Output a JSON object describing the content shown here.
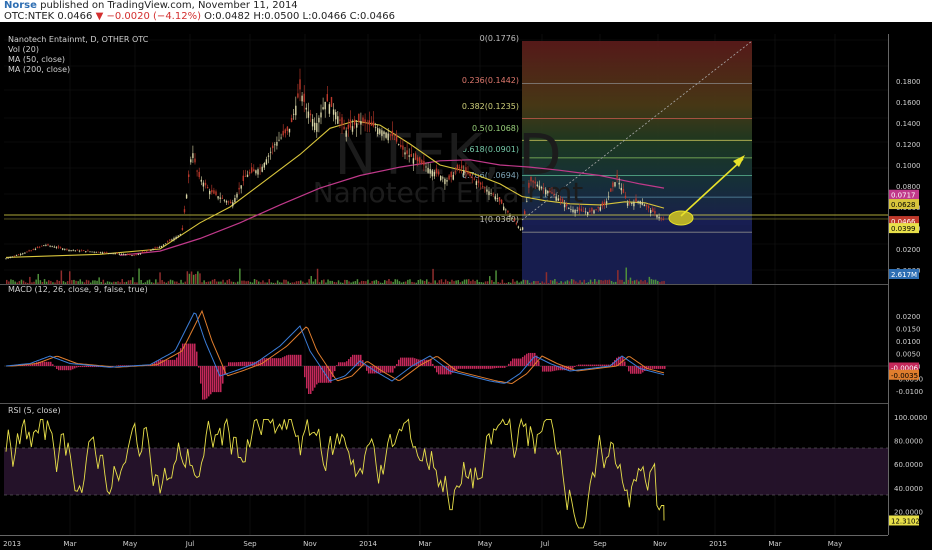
{
  "header": {
    "author": "Norse",
    "published": "published on TradingView.com, November 11, 2014",
    "symbol": "OTC:NTEK",
    "last": "0.0466",
    "change": "−0.0020 (−4.12%)",
    "open": "O:0.0482",
    "high": "H:0.0500",
    "low": "L:0.0466",
    "close": "C:0.0466"
  },
  "main_pane": {
    "title": "Nanotech Entainmt, D, OTHER OTC",
    "indicators": [
      "Vol (20)",
      "MA (50, close)",
      "MA (200, close)"
    ],
    "watermark_symbol": "NTEK, D",
    "watermark_name": "Nanotech Entainmt"
  },
  "macd_pane": {
    "title": "MACD (12, 26, close, 9, false, true)"
  },
  "rsi_pane": {
    "title": "RSI (5, close)"
  },
  "colors": {
    "price": "#d9d5a7",
    "ma50": "#d8c53c",
    "ma200": "#c0398a",
    "macd": "#3b7dd8",
    "signal": "#e07d2d",
    "hist": "#c4285a",
    "rsi": "#e8e04a",
    "arrow": "#e8e22a"
  },
  "chart_data": [
    {
      "type": "line",
      "pane": "price",
      "x": [
        "2013-01",
        "2013-03",
        "2013-05",
        "2013-07",
        "2013-09",
        "2013-11",
        "2014-01",
        "2014-03",
        "2014-05",
        "2014-06",
        "2014-07",
        "2014-09",
        "2014-11"
      ],
      "series": [
        {
          "values": [
            0.012,
            0.022,
            0.018,
            0.06,
            0.095,
            0.17,
            0.145,
            0.115,
            0.085,
            0.036,
            0.08,
            0.065,
            0.047
          ]
        }
      ],
      "y_ticks": [
        "0.1800",
        "0.1600",
        "0.1400",
        "0.1200",
        "0.1000",
        "0.0800",
        "0.0600",
        "0.0400",
        "0.0200",
        "0.0000"
      ],
      "price_labels": [
        "0.0717",
        "0.0628",
        "0.0466",
        "0.0399",
        "2.617M"
      ],
      "fib_levels": [
        "0(0.1776)",
        "0.236(0.1442)",
        "0.382(0.1235)",
        "0.5(0.1068)",
        "0.618(0.0901)",
        "0.786(0.0694)",
        "1(0.0360)"
      ],
      "fib_values": [
        0.1776,
        0.1442,
        0.1235,
        0.1068,
        0.0901,
        0.0694,
        0.036
      ]
    },
    {
      "type": "line",
      "pane": "macd",
      "y_ticks": [
        "0.0200",
        "0.0150",
        "0.0100",
        "0.0050",
        "0.0000",
        "-0.0050",
        "-0.0100"
      ],
      "price_labels": [
        "-0.0006",
        "-0.0035"
      ]
    },
    {
      "type": "line",
      "pane": "rsi",
      "y_ticks": [
        "100.0000",
        "80.0000",
        "60.0000",
        "40.0000",
        "20.0000"
      ],
      "price_labels": [
        "12.3102"
      ],
      "x_ticks": [
        "2013",
        "Mar",
        "May",
        "Jul",
        "Sep",
        "Nov",
        "2014",
        "Mar",
        "May",
        "Jul",
        "Sep",
        "Nov",
        "2015",
        "Mar",
        "May"
      ]
    }
  ]
}
